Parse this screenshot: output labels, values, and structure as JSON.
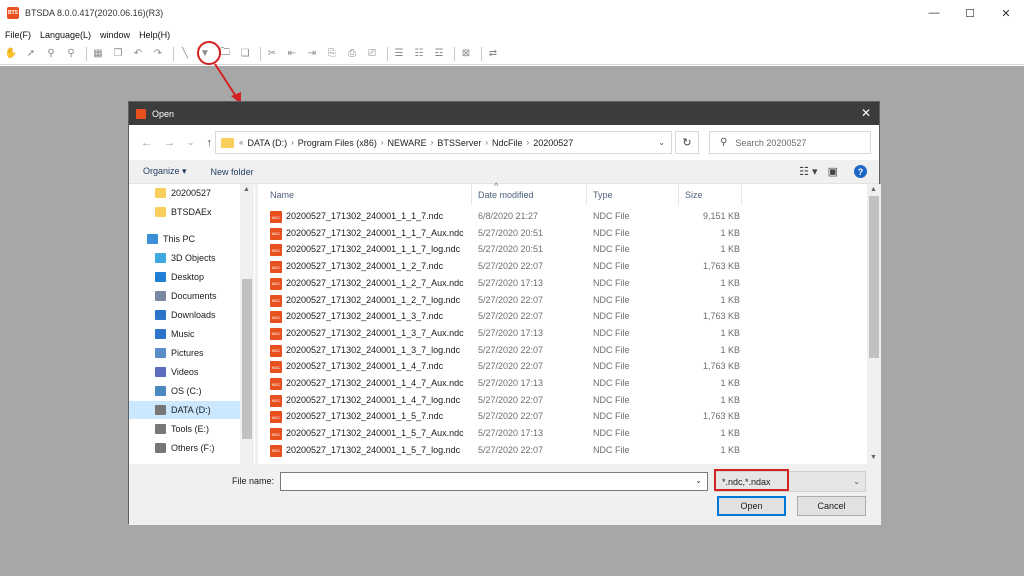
{
  "app": {
    "icon_text": "BTS",
    "title": "BTSDA 8.0.0.417(2020.06.16)(R3)",
    "window_controls": [
      "—",
      "☐",
      "✕"
    ]
  },
  "menu": [
    "File(F)",
    "Language(L)",
    "window",
    "Help(H)"
  ],
  "toolbar_icons": [
    "hand-icon",
    "pointer-icon",
    "zoom-in-icon",
    "zoom-out-icon",
    "grid-icon",
    "copy-icon",
    "undo-icon",
    "redo-icon",
    "line-icon",
    "filter-icon",
    "open-folder-icon",
    "save-icon",
    "tool-icon",
    "first-icon",
    "prev-icon",
    "next-icon",
    "cycle-icon",
    "step-icon",
    "table-icon",
    "table2-icon",
    "table3-icon",
    "excel-icon",
    "export-icon"
  ],
  "dialog": {
    "title": "Open",
    "close": "✕",
    "nav": {
      "back": "←",
      "forward": "→",
      "dropdown": "⌄",
      "up": "↑"
    },
    "breadcrumb_prefix": "«",
    "breadcrumb": [
      "DATA (D:)",
      "Program Files (x86)",
      "NEWARE",
      "BTSServer",
      "NdcFile",
      "20200527"
    ],
    "search_placeholder": "Search 20200527",
    "organize": "Organize ▾",
    "new_folder": "New folder",
    "sidebar": [
      {
        "label": "20200527",
        "icon": "folder-icon",
        "color": "#f8cf5c"
      },
      {
        "label": "BTSDAEx",
        "icon": "folder-icon",
        "color": "#f8cf5c"
      },
      {
        "label": "This PC",
        "icon": "pc-icon",
        "color": "#3a8fd6"
      },
      {
        "label": "3D Objects",
        "icon": "cube-icon",
        "color": "#3fa9e0"
      },
      {
        "label": "Desktop",
        "icon": "desktop-icon",
        "color": "#1e7fd4"
      },
      {
        "label": "Documents",
        "icon": "document-icon",
        "color": "#7a8aa0"
      },
      {
        "label": "Downloads",
        "icon": "download-icon",
        "color": "#2b74c9"
      },
      {
        "label": "Music",
        "icon": "music-icon",
        "color": "#2b74c9"
      },
      {
        "label": "Pictures",
        "icon": "picture-icon",
        "color": "#5b8ec8"
      },
      {
        "label": "Videos",
        "icon": "video-icon",
        "color": "#5b6cc0"
      },
      {
        "label": "OS (C:)",
        "icon": "drive-icon",
        "color": "#4a8ac0"
      },
      {
        "label": "DATA (D:)",
        "icon": "drive-icon",
        "color": "#777777"
      },
      {
        "label": "Tools (E:)",
        "icon": "drive-icon",
        "color": "#777777"
      },
      {
        "label": "Others (F:)",
        "icon": "drive-icon",
        "color": "#777777"
      }
    ],
    "columns": [
      "Name",
      "Date modified",
      "Type",
      "Size"
    ],
    "file_icon_text": "NDC",
    "files": [
      {
        "name": "20200527_171302_240001_1_1_7.ndc",
        "date": "6/8/2020 21:27",
        "type": "NDC File",
        "size": "9,151 KB"
      },
      {
        "name": "20200527_171302_240001_1_1_7_Aux.ndc",
        "date": "5/27/2020 20:51",
        "type": "NDC File",
        "size": "1 KB"
      },
      {
        "name": "20200527_171302_240001_1_1_7_log.ndc",
        "date": "5/27/2020 20:51",
        "type": "NDC File",
        "size": "1 KB"
      },
      {
        "name": "20200527_171302_240001_1_2_7.ndc",
        "date": "5/27/2020 22:07",
        "type": "NDC File",
        "size": "1,763 KB"
      },
      {
        "name": "20200527_171302_240001_1_2_7_Aux.ndc",
        "date": "5/27/2020 17:13",
        "type": "NDC File",
        "size": "1 KB"
      },
      {
        "name": "20200527_171302_240001_1_2_7_log.ndc",
        "date": "5/27/2020 22:07",
        "type": "NDC File",
        "size": "1 KB"
      },
      {
        "name": "20200527_171302_240001_1_3_7.ndc",
        "date": "5/27/2020 22:07",
        "type": "NDC File",
        "size": "1,763 KB"
      },
      {
        "name": "20200527_171302_240001_1_3_7_Aux.ndc",
        "date": "5/27/2020 17:13",
        "type": "NDC File",
        "size": "1 KB"
      },
      {
        "name": "20200527_171302_240001_1_3_7_log.ndc",
        "date": "5/27/2020 22:07",
        "type": "NDC File",
        "size": "1 KB"
      },
      {
        "name": "20200527_171302_240001_1_4_7.ndc",
        "date": "5/27/2020 22:07",
        "type": "NDC File",
        "size": "1,763 KB"
      },
      {
        "name": "20200527_171302_240001_1_4_7_Aux.ndc",
        "date": "5/27/2020 17:13",
        "type": "NDC File",
        "size": "1 KB"
      },
      {
        "name": "20200527_171302_240001_1_4_7_log.ndc",
        "date": "5/27/2020 22:07",
        "type": "NDC File",
        "size": "1 KB"
      },
      {
        "name": "20200527_171302_240001_1_5_7.ndc",
        "date": "5/27/2020 22:07",
        "type": "NDC File",
        "size": "1,763 KB"
      },
      {
        "name": "20200527_171302_240001_1_5_7_Aux.ndc",
        "date": "5/27/2020 17:13",
        "type": "NDC File",
        "size": "1 KB"
      },
      {
        "name": "20200527_171302_240001_1_5_7_log.ndc",
        "date": "5/27/2020 22:07",
        "type": "NDC File",
        "size": "1 KB"
      }
    ],
    "filename_label": "File name:",
    "filename_value": "",
    "filetype_value": "*.ndc,*.ndax",
    "open_button": "Open",
    "cancel_button": "Cancel"
  },
  "colors": {
    "accent_blue": "#0078d7",
    "callout_red": "#d32020",
    "file_icon": "#e8501f"
  }
}
